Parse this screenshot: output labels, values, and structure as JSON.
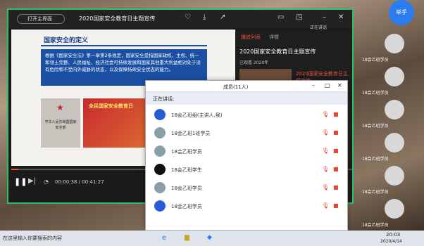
{
  "player": {
    "open_label": "打开主界面",
    "title": "2020国家安全教育日主题宣传",
    "toolbar_icons": [
      "heart-icon",
      "download-icon",
      "share-icon",
      "window-icon",
      "pip-icon",
      "minimize-icon",
      "close-icon"
    ],
    "speaking": "正在讲话"
  },
  "slide": {
    "heading": "国家安全的定义",
    "body": "根据《国家安全法》第一章第2条规定，国家安全是指国家政权、主权、统一和领土完整、人民福祉、经济社会可持续发展和国家其他重大利益相对处于没有危险和不受内外威胁的状态，以及保障持续安全状态的能力。",
    "plaque": "中华人民共和国国家安全部",
    "banner": "全民国家安全教育日"
  },
  "right_panel": {
    "tab_playlist": "播放列表",
    "tab_detail": "详情",
    "item_title": "2020国家安全教育日主题宣传",
    "item_sub": "已观看  2020年",
    "thumb_text": "2020国家安全教育日主题宣传"
  },
  "controls": {
    "time": "00:00:38 / 00:41:27",
    "progress": 0.02
  },
  "members": {
    "title": "成员(11人)",
    "speaking_label": "正在讲话:",
    "rows": [
      {
        "name": "18会乙班组(主讲人,我)",
        "avatar": "dingtalk"
      },
      {
        "name": "18会乙班1班学员",
        "avatar": "photo"
      },
      {
        "name": "18会乙班学员",
        "avatar": "photo"
      },
      {
        "name": "18会乙班学生",
        "avatar": "dark"
      },
      {
        "name": "18会乙班学员",
        "avatar": "photo"
      },
      {
        "name": "18会乙班学员",
        "avatar": "blue"
      }
    ]
  },
  "side": {
    "raise_hand": "举手",
    "tiles": [
      "18会乙班学员",
      "18会乙班学员",
      "18会乙班学员",
      "18会乙班学员",
      "18会乙班学员",
      "18会乙班学员"
    ]
  },
  "taskbar": {
    "search": "在这里输入你要搜索的内容",
    "time": "20:03",
    "date": "2020/4/14"
  }
}
